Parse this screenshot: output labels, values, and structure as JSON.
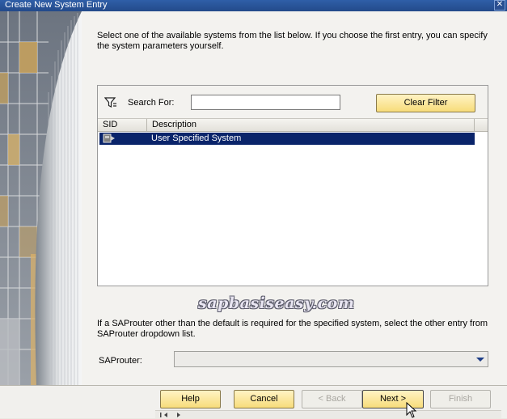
{
  "window": {
    "title": "Create New System Entry",
    "close_glyph": "✕"
  },
  "intro_text": "Select one of the available systems from the list below. If you choose the first entry, you can specify the system parameters yourself.",
  "filter": {
    "search_label": "Search For:",
    "search_value": "",
    "clear_filter_label": "Clear Filter",
    "icon": "filter-funnel-icon"
  },
  "table": {
    "columns": [
      "SID",
      "Description"
    ],
    "rows": [
      {
        "sid": "",
        "icon": "system-computer-icon",
        "description": "User Specified System",
        "selected": true
      }
    ]
  },
  "watermark": "sapbasiseasy.com",
  "saprouter": {
    "info_text": "If a SAProuter other than the default is required for the specified system, select the other entry from SAProuter dropdown list.",
    "label": "SAProuter:",
    "selected_value": ""
  },
  "buttons": {
    "help": "Help",
    "cancel": "Cancel",
    "back": "< Back",
    "next": "Next >",
    "finish": "Finish"
  },
  "colors": {
    "titlebar": "#2f5fa8",
    "button_face": "#f7dc7a",
    "selection": "#0a246a"
  }
}
